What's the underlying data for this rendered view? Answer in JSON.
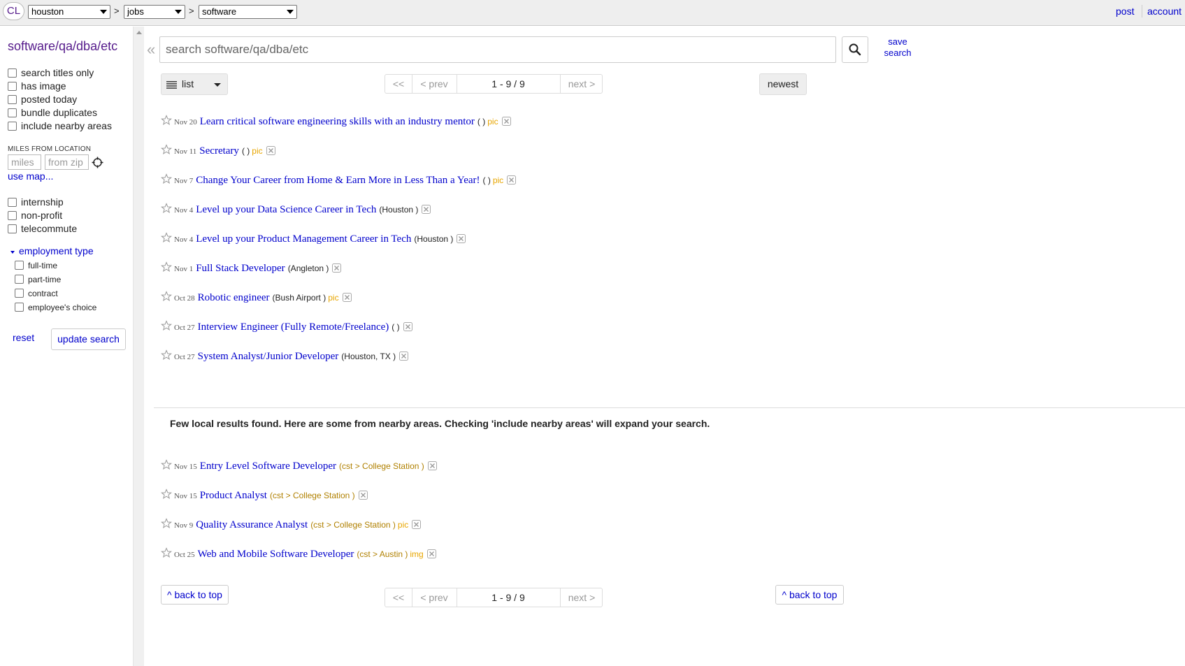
{
  "topbar": {
    "logo": "CL",
    "breadcrumbs": [
      {
        "value": "houston"
      },
      {
        "value": "jobs"
      },
      {
        "value": "software"
      }
    ],
    "separator": ">",
    "links": {
      "post": "post",
      "account": "account"
    }
  },
  "sidebar": {
    "title": "software/qa/dba/etc",
    "filters": [
      {
        "label": "search titles only"
      },
      {
        "label": "has image"
      },
      {
        "label": "posted today"
      },
      {
        "label": "bundle duplicates"
      },
      {
        "label": "include nearby areas"
      }
    ],
    "miles_label": "MILES FROM LOCATION",
    "miles_placeholder": "miles",
    "zip_placeholder": "from zip",
    "use_map": "use map...",
    "job_filters": [
      {
        "label": "internship"
      },
      {
        "label": "non-profit"
      },
      {
        "label": "telecommute"
      }
    ],
    "employment_type": {
      "label": "employment type",
      "options": [
        {
          "label": "full-time"
        },
        {
          "label": "part-time"
        },
        {
          "label": "contract"
        },
        {
          "label": "employee's choice"
        }
      ]
    },
    "reset": "reset",
    "update_search": "update search"
  },
  "main": {
    "collapse": "«",
    "search_placeholder": "search software/qa/dba/etc",
    "save_search": "save search",
    "view": "list",
    "pager": {
      "first": "<<",
      "prev": "< prev",
      "range": "1 - 9 / 9",
      "next": "next >"
    },
    "sort": "newest",
    "results": [
      {
        "date": "Nov 20",
        "title": "Learn critical software engineering skills with an industry mentor",
        "hood": "( )",
        "pic": "pic"
      },
      {
        "date": "Nov 11",
        "title": "Secretary",
        "hood": "( )",
        "pic": "pic"
      },
      {
        "date": "Nov 7",
        "title": "Change Your Career from Home & Earn More in Less Than a Year!",
        "hood": "( )",
        "pic": "pic"
      },
      {
        "date": "Nov 4",
        "title": "Level up your Data Science Career in Tech",
        "hood": "(Houston )",
        "pic": ""
      },
      {
        "date": "Nov 4",
        "title": "Level up your Product Management Career in Tech",
        "hood": "(Houston )",
        "pic": ""
      },
      {
        "date": "Nov 1",
        "title": "Full Stack Developer",
        "hood": "(Angleton )",
        "pic": ""
      },
      {
        "date": "Oct 28",
        "title": "Robotic engineer",
        "hood": "(Bush Airport )",
        "pic": "pic"
      },
      {
        "date": "Oct 27",
        "title": "Interview Engineer (Fully Remote/Freelance)",
        "hood": "( )",
        "pic": ""
      },
      {
        "date": "Oct 27",
        "title": "System Analyst/Junior Developer",
        "hood": "(Houston, TX )",
        "pic": ""
      }
    ],
    "nearby_message": "Few local results found. Here are some from nearby areas. Checking 'include nearby areas' will expand your search.",
    "nearby_results": [
      {
        "date": "Nov 15",
        "title": "Entry Level Software Developer",
        "hood": "(cst > College Station )",
        "pic": ""
      },
      {
        "date": "Nov 15",
        "title": "Product Analyst",
        "hood": "(cst > College Station )",
        "pic": ""
      },
      {
        "date": "Nov 9",
        "title": "Quality Assurance Analyst",
        "hood": "(cst > College Station )",
        "pic": "pic"
      },
      {
        "date": "Oct 25",
        "title": "Web and Mobile Software Developer",
        "hood": "(cst > Austin )",
        "pic": "img"
      }
    ],
    "back_to_top": "^ back to top"
  }
}
